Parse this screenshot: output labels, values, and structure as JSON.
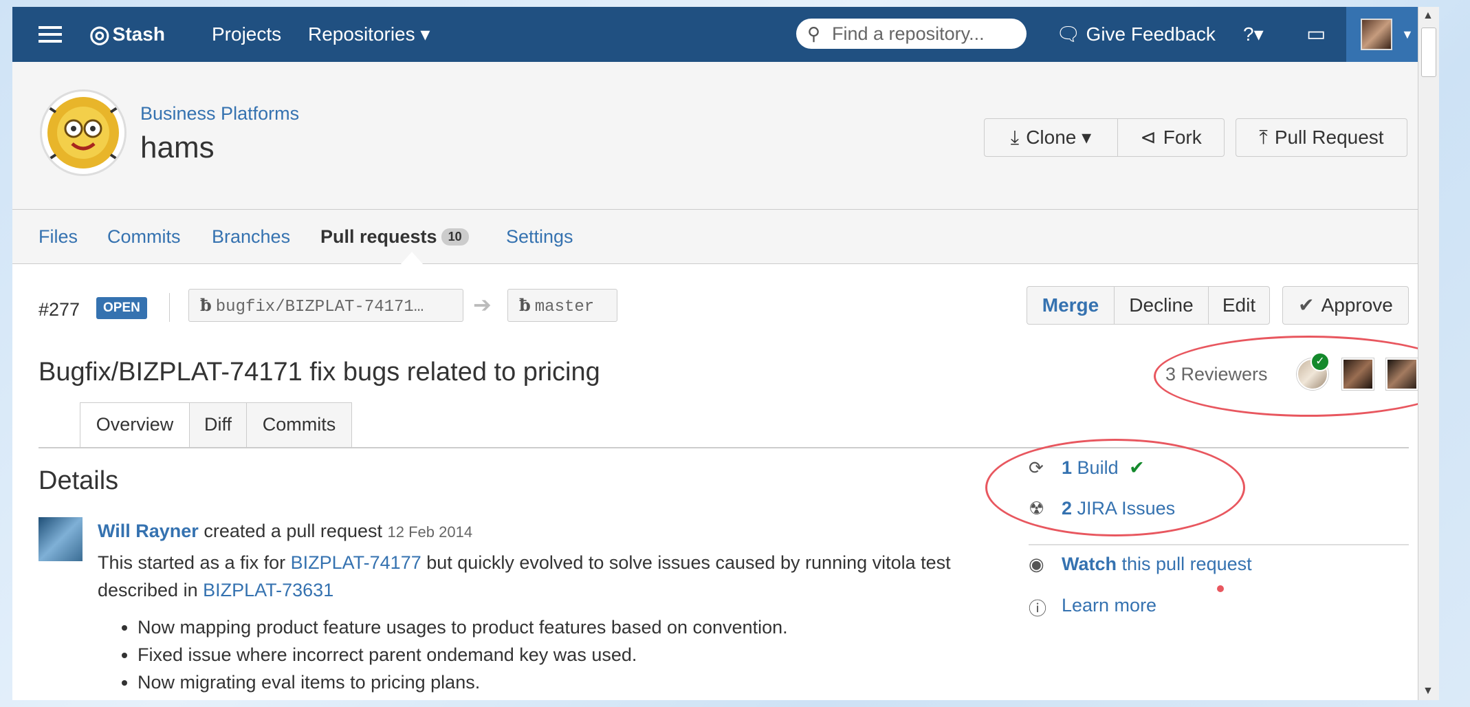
{
  "header": {
    "logo_label": "Stash",
    "nav": {
      "projects": "Projects",
      "repositories": "Repositories ▾"
    },
    "search_placeholder": "Find a repository...",
    "feedback": "Give Feedback",
    "help": "?▾",
    "colors": {
      "header_bg": "#205081",
      "user_area": "#3572b0"
    }
  },
  "repo": {
    "project": "Business Platforms",
    "name": "hams",
    "clone": "Clone ▾",
    "fork": "Fork",
    "pull_request": "Pull Request"
  },
  "repo_nav": {
    "files": "Files",
    "commits": "Commits",
    "branches": "Branches",
    "pull_requests": "Pull requests",
    "pull_requests_count": "10",
    "settings": "Settings"
  },
  "pr": {
    "id": "#277",
    "state": "OPEN",
    "source_branch": "bugfix/BIZPLAT-74171…",
    "target_branch": "master",
    "actions": {
      "merge": "Merge",
      "decline": "Decline",
      "edit": "Edit",
      "approve": "Approve"
    },
    "title": "Bugfix/BIZPLAT-74171 fix bugs related to pricing",
    "reviewers_label": "3 Reviewers",
    "tabs": {
      "overview": "Overview",
      "diff": "Diff",
      "commits": "Commits"
    }
  },
  "details": {
    "heading": "Details",
    "author": "Will Rayner",
    "action": "created a pull request",
    "date": "12 Feb 2014",
    "desc_1": "This started as a fix for",
    "issue_1": "BIZPLAT-74177",
    "desc_2": "but quickly evolved to solve issues caused by running vitola test described in",
    "issue_2": "BIZPLAT-73631",
    "bullets": [
      "Now mapping product feature usages to product features based on convention.",
      "Fixed issue where incorrect parent ondemand key was used.",
      "Now migrating eval items to pricing plans."
    ]
  },
  "sidebar": {
    "build_count": "1",
    "build_label": "Build",
    "jira_count": "2",
    "jira_label": "JIRA Issues",
    "watch_bold": "Watch",
    "watch_rest": "this pull request",
    "learn_more": "Learn more"
  }
}
